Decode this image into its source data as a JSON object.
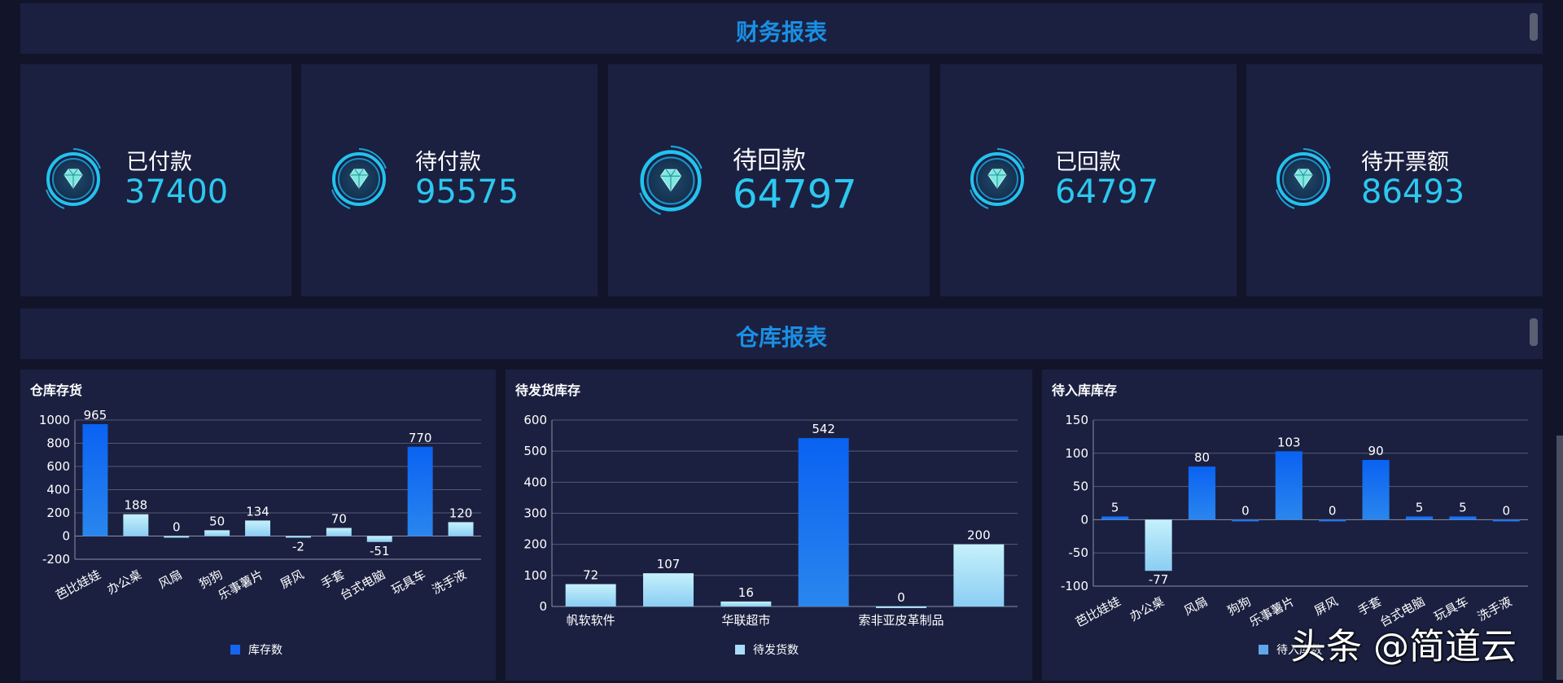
{
  "finance": {
    "title": "财务报表",
    "cards": [
      {
        "label": "已付款",
        "value": "37400"
      },
      {
        "label": "待付款",
        "value": "95575"
      },
      {
        "label": "待回款",
        "value": "64797"
      },
      {
        "label": "已回款",
        "value": "64797"
      },
      {
        "label": "待开票额",
        "value": "86493"
      }
    ]
  },
  "warehouse": {
    "title": "仓库报表"
  },
  "watermark": "头条 @简道云",
  "colors": {
    "background": "#12152a",
    "panel": "#1b2040",
    "accent_title": "#1a8fe3",
    "value_cyan": "#2cc8f0",
    "bar_dark_blue": "#1565f0",
    "bar_light_blue": "#a8def7"
  },
  "chart_data": [
    {
      "type": "bar",
      "title": "仓库存货",
      "categories": [
        "芭比娃娃",
        "办公桌",
        "风扇",
        "狗狗",
        "乐事薯片",
        "屏风",
        "手套",
        "台式电脑",
        "玩具车",
        "洗手液"
      ],
      "series": [
        {
          "name": "库存数",
          "values": [
            965,
            188,
            0,
            50,
            134,
            -2,
            70,
            -51,
            770,
            120
          ]
        }
      ],
      "ylim": [
        -200,
        1000
      ],
      "yticks": [
        -200,
        0,
        200,
        400,
        600,
        800,
        1000
      ],
      "grid": true,
      "legend": "bottom"
    },
    {
      "type": "bar",
      "title": "待发货库存",
      "categories": [
        "帆软软件",
        "",
        "华联超市",
        "",
        "索非亚皮革制品",
        ""
      ],
      "series": [
        {
          "name": "待发货数",
          "values": [
            72,
            107,
            16,
            542,
            0,
            200
          ]
        }
      ],
      "ylim": [
        0,
        600
      ],
      "yticks": [
        0,
        100,
        200,
        300,
        400,
        500,
        600
      ],
      "grid": true,
      "legend": "bottom"
    },
    {
      "type": "bar",
      "title": "待入库库存",
      "categories": [
        "芭比娃娃",
        "办公桌",
        "风扇",
        "狗狗",
        "乐事薯片",
        "屏风",
        "手套",
        "台式电脑",
        "玩具车",
        "洗手液"
      ],
      "series": [
        {
          "name": "待入库数",
          "values": [
            5,
            -77,
            80,
            0,
            103,
            0,
            90,
            5,
            5,
            0
          ]
        }
      ],
      "ylim": [
        -100,
        150
      ],
      "yticks": [
        -100,
        -50,
        0,
        50,
        100,
        150
      ],
      "grid": true,
      "legend": "bottom"
    }
  ]
}
